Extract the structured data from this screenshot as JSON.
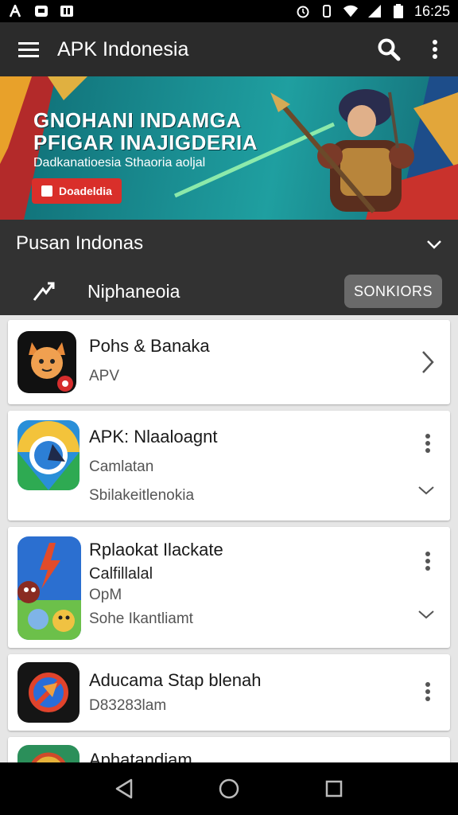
{
  "status": {
    "time": "16:25",
    "left_icons": [
      "a-icon",
      "message-icon",
      "app-icon"
    ],
    "right_icons": [
      "alarm-icon",
      "vibrate-icon",
      "wifi-icon",
      "signal-icon",
      "battery-icon"
    ]
  },
  "appbar": {
    "title": "APK Indonesia"
  },
  "banner": {
    "headline1": "GNOHANI INDAMGA",
    "headline2": "PFIGAR INAJIGDERIA",
    "subtitle": "Dadkanatioesia Sthaoria aoljal",
    "cta": "Doadeldia"
  },
  "section": {
    "title": "Pusan Indonas",
    "filter_label": "Niphaneoia",
    "action_button": "SONKIORS"
  },
  "apps": [
    {
      "name": "Pohs & Banaka",
      "lines": [
        "APV"
      ]
    },
    {
      "name": "APK: Nlaaloagnt",
      "lines": [
        "Camlatan",
        "Sbilakeitlenokia"
      ]
    },
    {
      "name": "Rplaokat Ilackate",
      "lines": [
        "Calfillalal",
        "OpM",
        "Sohe Ikantliamt"
      ]
    },
    {
      "name": "Aducama Stap blenah",
      "lines": [
        "D83283lam"
      ]
    },
    {
      "name": "Aphatandiam",
      "lines": []
    }
  ],
  "colors": {
    "statusbar": "#000000",
    "appbar": "#2b2b2b",
    "section": "#323232",
    "cta": "#d92f2a",
    "banner": "#1a8e92"
  }
}
